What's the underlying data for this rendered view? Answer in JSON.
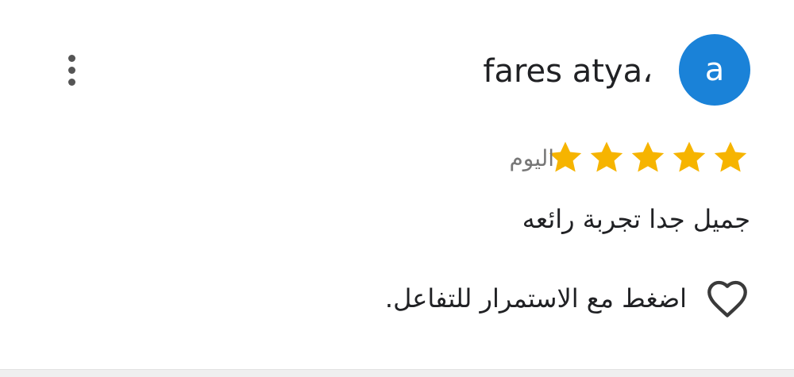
{
  "review": {
    "avatar_letter": "a",
    "author_name": "fares atya،",
    "rating": 5,
    "max_rating": 5,
    "date": "اليوم",
    "text": "جميل جدا تجربة رائعه",
    "like_prompt": "اضغط مع الاستمرار للتفاعل."
  },
  "colors": {
    "avatar": "#1a82d8",
    "star": "#f6b400",
    "secondary_text": "#777777"
  },
  "icons": {
    "menu": "more-vert-icon",
    "heart": "heart-outline-icon",
    "star": "star-icon"
  }
}
